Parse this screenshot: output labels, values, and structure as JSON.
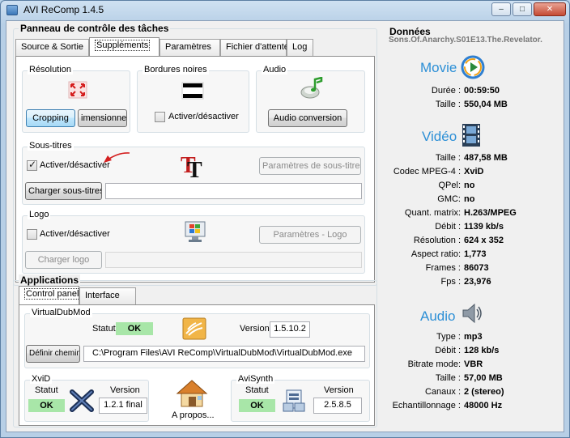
{
  "window": {
    "title": "AVI ReComp  1.4.5",
    "min_glyph": "–",
    "max_glyph": "□",
    "close_glyph": "✕"
  },
  "tasks": {
    "title": "Panneau de contrôle des tâches",
    "tabs": [
      "Source & Sortie",
      "Suppléments",
      "Paramètres",
      "Fichier d'attente",
      "Log"
    ],
    "active_tab": 1,
    "resolution": {
      "label": "Résolution",
      "crop": "Cropping",
      "resize": "imensionner"
    },
    "borders": {
      "label": "Bordures noires",
      "toggle": "Activer/désactiver"
    },
    "audio": {
      "label": "Audio",
      "conversion": "Audio conversion"
    },
    "subtitles": {
      "label": "Sous-titres",
      "toggle": "Activer/désactiver",
      "settings": "Paramètres de sous-titres",
      "load": "Charger sous-titres",
      "file": ""
    },
    "logo": {
      "label": "Logo",
      "toggle": "Activer/désactiver",
      "settings": "Paramètres - Logo",
      "load": "Charger logo",
      "file": ""
    }
  },
  "apps": {
    "title": "Applications",
    "tabs": [
      "Control panel",
      "Interface"
    ],
    "active_tab": 0,
    "virtualdub": {
      "label": "VirtualDubMod",
      "status_label": "Statut",
      "status": "OK",
      "version_label": "Version",
      "version": "1.5.10.2",
      "define": "Définir chemin",
      "path": "C:\\Program Files\\AVI ReComp\\VirtualDubMod\\VirtualDubMod.exe"
    },
    "xvid": {
      "label": "XviD",
      "status_label": "Statut",
      "status": "OK",
      "version_label": "Version",
      "version": "1.2.1 final"
    },
    "about": "A propos...",
    "avisynth": {
      "label": "AviSynth",
      "status_label": "Statut",
      "status": "OK",
      "version_label": "Version",
      "version": "2.5.8.5"
    }
  },
  "data": {
    "title": "Données",
    "filename": "Sons.Of.Anarchy.S01E13.The.Revelator.",
    "movie": {
      "title": "Movie",
      "rows": [
        {
          "k": "Durée :",
          "v": "00:59:50"
        },
        {
          "k": "Taille :",
          "v": "550,04 MB"
        }
      ]
    },
    "video": {
      "title": "Vidéo",
      "rows": [
        {
          "k": "Taille :",
          "v": "487,58 MB"
        },
        {
          "k": "Codec MPEG-4 :",
          "v": "XviD"
        },
        {
          "k": "QPel:",
          "v": "no"
        },
        {
          "k": "GMC:",
          "v": "no"
        },
        {
          "k": "Quant. matrix:",
          "v": "H.263/MPEG"
        },
        {
          "k": "Débit :",
          "v": "1139 kb/s"
        },
        {
          "k": "Résolution :",
          "v": "624 x 352"
        },
        {
          "k": "Aspect ratio:",
          "v": "1,773"
        },
        {
          "k": "Frames :",
          "v": "86073"
        },
        {
          "k": "Fps :",
          "v": "23,976"
        }
      ]
    },
    "audio": {
      "title": "Audio",
      "rows": [
        {
          "k": "Type :",
          "v": "mp3"
        },
        {
          "k": "Débit :",
          "v": "128 kb/s"
        },
        {
          "k": "Bitrate mode:",
          "v": "VBR"
        },
        {
          "k": "Taille :",
          "v": "57,00 MB"
        },
        {
          "k": "Canaux :",
          "v": "2 (stereo)"
        },
        {
          "k": "Echantillonnage :",
          "v": "48000 Hz"
        }
      ]
    }
  }
}
